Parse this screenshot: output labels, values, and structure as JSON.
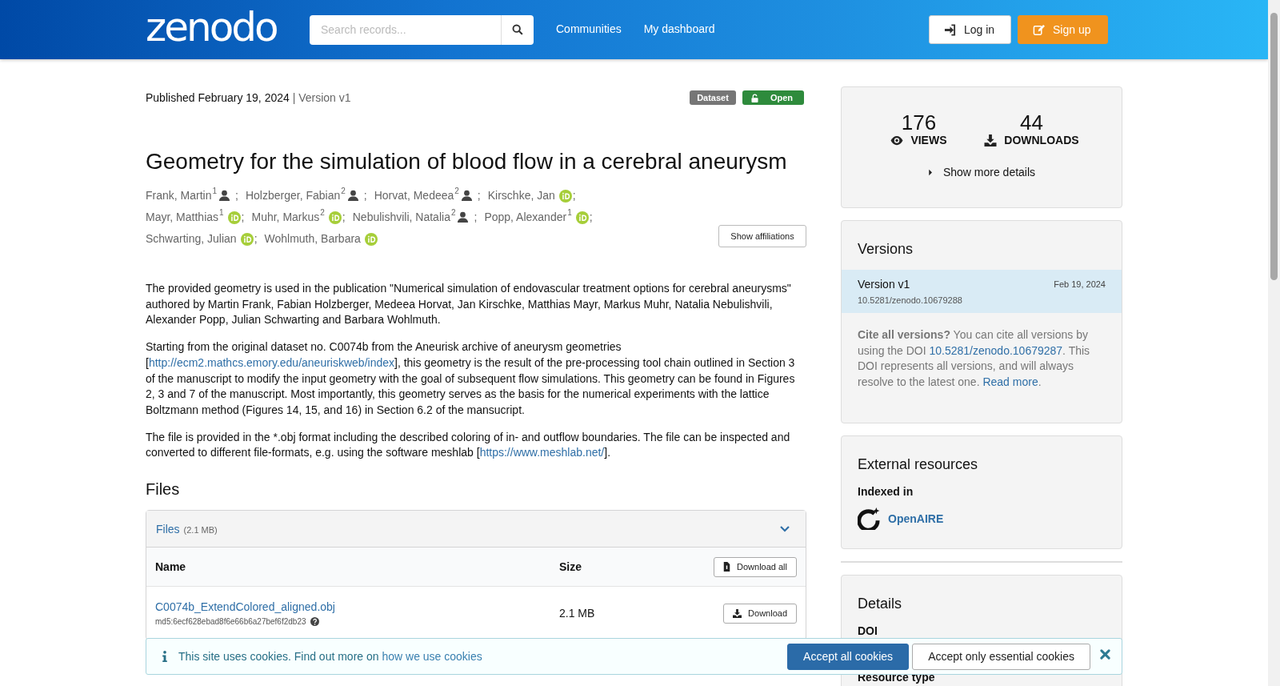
{
  "header": {
    "logo": "zenodo",
    "search": {
      "placeholder": "Search records..."
    },
    "nav": [
      "Communities",
      "My dashboard"
    ],
    "buttons": [
      {
        "label": "Log in",
        "kind": "login"
      },
      {
        "label": "Sign up",
        "kind": "signup"
      }
    ]
  },
  "record": {
    "published": "Published February 19, 2024",
    "version": "| Version v1",
    "badges": [
      {
        "label": "Dataset",
        "kind": "type"
      },
      {
        "label": "Open",
        "kind": "access"
      }
    ],
    "title": "Geometry for the simulation of blood flow in a cerebral aneurysm",
    "authors": [
      {
        "name": "Frank, Martin",
        "affiliation": "1",
        "kind": "person",
        "separator": ";"
      },
      {
        "name": "Holzberger, Fabian",
        "affiliation": "2",
        "kind": "person",
        "separator": ";"
      },
      {
        "name": "Horvat, Medeea",
        "affiliation": "2",
        "kind": "person",
        "separator": ";"
      },
      {
        "name": "Kirschke, Jan",
        "kind": "orcid",
        "separator": ";"
      },
      {
        "name": "Mayr, Matthias",
        "affiliation": "1",
        "kind": "orcid",
        "separator": ";"
      },
      {
        "name": "Muhr, Markus",
        "affiliation": "2",
        "kind": "orcid",
        "separator": ";"
      },
      {
        "name": "Nebulishvili, Natalia",
        "affiliation": "2",
        "kind": "person",
        "separator": ";"
      },
      {
        "name": "Popp, Alexander",
        "affiliation": "1",
        "kind": "orcid",
        "separator": ";"
      },
      {
        "name": "Schwarting, Julian",
        "kind": "orcid",
        "separator": ";"
      },
      {
        "name": "Wohlmuth, Barbara",
        "kind": "orcid"
      }
    ],
    "show_affiliations": "Show affiliations",
    "description": [
      [
        {
          "text": "The provided geometry is used in the publication \"Numerical simulation of endovascular treatment options for cerebral aneurysms\" authored by Martin Frank, Fabian Holzberger, Medeea Horvat, Jan Kirschke, Matthias Mayr, Markus Muhr, Natalia Nebulishvili, Alexander Popp, Julian Schwarting and Barbara Wohlmuth."
        }
      ],
      [
        {
          "text": "Starting from the original dataset no. C0074b from the Aneurisk archive of aneurysm geometries ["
        },
        {
          "text": "http://ecm2.mathcs.emory.edu/aneuriskweb/index",
          "kind": "link"
        },
        {
          "text": "], this geometry is the result of the pre-processing tool chain outlined in Section 3 of the manuscript to modify the input geometry with the goal of subsequent flow simulations. This geometry can be found in Figures 2, 3 and 7 of the manuscript. Most importantly, this geometry serves as the basis for the numerical experiments with the lattice Boltzmann method (Figures 14, 15,  and 16) in Section 6.2 of the mansucript."
        }
      ],
      [
        {
          "text": "The file is provided in the *.obj format including the described coloring of in- and outflow boundaries. The file can be inspected and converted to different file-formats, e.g. using the software meshlab ["
        },
        {
          "text": "https://www.meshlab.net/",
          "kind": "link"
        },
        {
          "text": "]."
        }
      ]
    ],
    "files": {
      "heading": "Files",
      "panel_title": "Files",
      "panel_size": "(2.1 MB)",
      "expanded": true,
      "columns": [
        "Name",
        "Size"
      ],
      "download_all": "Download all",
      "rows": [
        {
          "name": "C0074b_ExtendColored_aligned.obj",
          "checksum": "md5:6ecf628ebad8f6e66b6a27bef6f2db23",
          "size": "2.1 MB",
          "action": "Download"
        }
      ]
    }
  },
  "sidebar": {
    "stats": [
      {
        "value": "176",
        "label": "VIEWS",
        "kind": "views"
      },
      {
        "value": "44",
        "label": "DOWNLOADS",
        "kind": "downloads"
      }
    ],
    "show_more": "Show more details",
    "versions": {
      "title": "Versions",
      "items": [
        {
          "label": "Version v1",
          "date": "Feb 19, 2024",
          "doi": "10.5281/zenodo.10679288",
          "selected": true
        }
      ],
      "cite": [
        {
          "text": "**Cite all versions?** You can cite all versions by using the DOI "
        },
        {
          "text": "10.5281/zenodo.10679287",
          "kind": "link"
        },
        {
          "text": ". This DOI represents all versions, and will always resolve to the latest one. "
        },
        {
          "text": "Read more",
          "kind": "link"
        },
        {
          "text": "."
        }
      ]
    },
    "external": {
      "title": "External resources",
      "indexed_label": "Indexed in",
      "items": [
        "OpenAIRE"
      ]
    },
    "details": {
      "title": "Details",
      "fields": [
        "DOI",
        "Resource type"
      ]
    }
  },
  "cookie_banner": {
    "text": [
      {
        "text": "This site uses cookies. Find out more on "
      },
      {
        "text": "how we use cookies",
        "kind": "link"
      }
    ],
    "buttons": [
      {
        "label": "Accept all cookies",
        "kind": "primary"
      },
      {
        "label": "Accept only essential cookies",
        "kind": "secondary"
      }
    ]
  }
}
